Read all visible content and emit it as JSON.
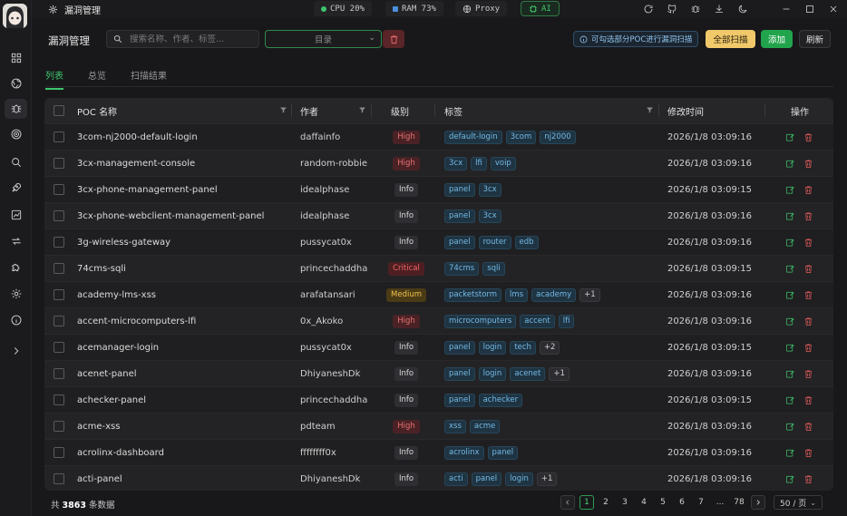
{
  "app": {
    "title": "漏洞管理"
  },
  "topbar": {
    "cpu": "CPU 20%",
    "ram": "RAM 73%",
    "proxy": "Proxy",
    "ai": "AI",
    "colors": {
      "cpu_dot": "#3ec46d",
      "ram_dot": "#4a8fe0",
      "ai": "#43c46b"
    }
  },
  "sidebar": {
    "items": [
      {
        "icon": "grid-icon"
      },
      {
        "icon": "globe-icon"
      },
      {
        "icon": "bug-icon",
        "active": true
      },
      {
        "icon": "target-icon"
      },
      {
        "icon": "search-icon"
      },
      {
        "icon": "rocket-icon"
      },
      {
        "icon": "chart-icon"
      },
      {
        "icon": "transfer-icon"
      },
      {
        "icon": "puzzle-icon"
      },
      {
        "icon": "settings-icon"
      },
      {
        "icon": "info-icon"
      },
      {
        "icon": "chevron-right-icon"
      }
    ]
  },
  "header": {
    "title": "漏洞管理",
    "search_placeholder": "搜索名称、作者、标签...",
    "dir_select": "目录",
    "hint": "可勾选部分POC进行漏洞扫描",
    "scan_all": "全部扫描",
    "add": "添加",
    "refresh": "刷新"
  },
  "tabs": [
    {
      "label": "列表",
      "active": true
    },
    {
      "label": "总览"
    },
    {
      "label": "扫描结果"
    }
  ],
  "table": {
    "columns": {
      "name": "POC 名称",
      "author": "作者",
      "severity": "级别",
      "tags": "标签",
      "modified": "修改时间",
      "actions": "操作"
    },
    "rows": [
      {
        "name": "3com-nj2000-default-login",
        "author": "daffainfo",
        "severity": "High",
        "tags": [
          "default-login",
          "3com",
          "nj2000"
        ],
        "more": "",
        "time": "2026/1/8 03:09:16"
      },
      {
        "name": "3cx-management-console",
        "author": "random-robbie",
        "severity": "High",
        "tags": [
          "3cx",
          "lfi",
          "voip"
        ],
        "more": "",
        "time": "2026/1/8 03:09:16"
      },
      {
        "name": "3cx-phone-management-panel",
        "author": "idealphase",
        "severity": "Info",
        "tags": [
          "panel",
          "3cx"
        ],
        "more": "",
        "time": "2026/1/8 03:09:15"
      },
      {
        "name": "3cx-phone-webclient-management-panel",
        "author": "idealphase",
        "severity": "Info",
        "tags": [
          "panel",
          "3cx"
        ],
        "more": "",
        "time": "2026/1/8 03:09:16"
      },
      {
        "name": "3g-wireless-gateway",
        "author": "pussycat0x",
        "severity": "Info",
        "tags": [
          "panel",
          "router",
          "edb"
        ],
        "more": "",
        "time": "2026/1/8 03:09:16"
      },
      {
        "name": "74cms-sqli",
        "author": "princechaddha",
        "severity": "Critical",
        "tags": [
          "74cms",
          "sqli"
        ],
        "more": "",
        "time": "2026/1/8 03:09:15"
      },
      {
        "name": "academy-lms-xss",
        "author": "arafatansari",
        "severity": "Medium",
        "tags": [
          "packetstorm",
          "lms",
          "academy"
        ],
        "more": "+1",
        "time": "2026/1/8 03:09:16"
      },
      {
        "name": "accent-microcomputers-lfi",
        "author": "0x_Akoko",
        "severity": "High",
        "tags": [
          "microcomputers",
          "accent",
          "lfi"
        ],
        "more": "",
        "time": "2026/1/8 03:09:16"
      },
      {
        "name": "acemanager-login",
        "author": "pussycat0x",
        "severity": "Info",
        "tags": [
          "panel",
          "login",
          "tech"
        ],
        "more": "+2",
        "time": "2026/1/8 03:09:15"
      },
      {
        "name": "acenet-panel",
        "author": "DhiyaneshDk",
        "severity": "Info",
        "tags": [
          "panel",
          "login",
          "acenet"
        ],
        "more": "+1",
        "time": "2026/1/8 03:09:16"
      },
      {
        "name": "achecker-panel",
        "author": "princechaddha",
        "severity": "Info",
        "tags": [
          "panel",
          "achecker"
        ],
        "more": "",
        "time": "2026/1/8 03:09:15"
      },
      {
        "name": "acme-xss",
        "author": "pdteam",
        "severity": "High",
        "tags": [
          "xss",
          "acme"
        ],
        "more": "",
        "time": "2026/1/8 03:09:16"
      },
      {
        "name": "acrolinx-dashboard",
        "author": "ffffffff0x",
        "severity": "Info",
        "tags": [
          "acrolinx",
          "panel"
        ],
        "more": "",
        "time": "2026/1/8 03:09:16"
      },
      {
        "name": "acti-panel",
        "author": "DhiyaneshDk",
        "severity": "Info",
        "tags": [
          "acti",
          "panel",
          "login"
        ],
        "more": "+1",
        "time": "2026/1/8 03:09:16"
      }
    ]
  },
  "footer": {
    "total_prefix": "共",
    "total": "3863",
    "total_suffix": "条数据",
    "pages": [
      "1",
      "2",
      "3",
      "4",
      "5",
      "6",
      "7",
      "...",
      "78"
    ],
    "current_page": "1",
    "page_size": "50 / 页"
  }
}
